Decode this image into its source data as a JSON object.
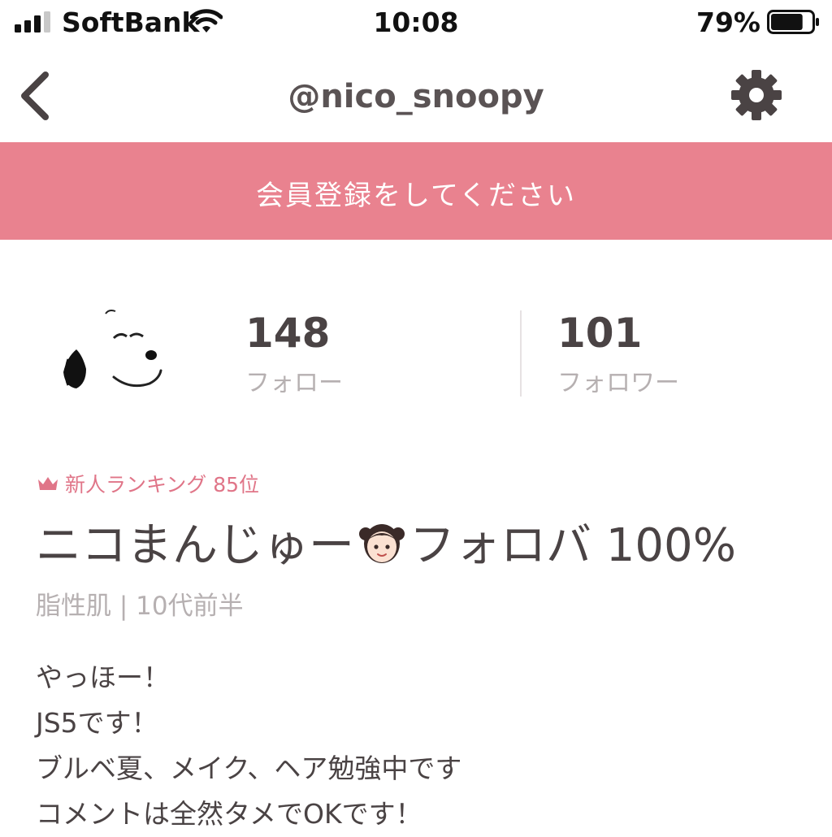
{
  "status_bar": {
    "carrier": "SoftBank",
    "time": "10:08",
    "battery_percent": "79%",
    "battery_level": 0.79
  },
  "nav": {
    "title": "@nico_snoopy",
    "back_icon": "chevron-left-icon",
    "settings_icon": "gear-icon"
  },
  "banner": {
    "text": "会員登録をしてください",
    "color": "#e9828f"
  },
  "profile": {
    "follow_count": "148",
    "follow_label": "フォロー",
    "follower_count": "101",
    "follower_label": "フォロワー",
    "rank_text": "新人ランキング 85位",
    "name_before": "ニコまんじゅー",
    "name_after": "フォロバ 100%",
    "meta": "脂性肌 | 10代前半",
    "bio": [
      "やっほー！",
      "JS5です！",
      "ブルベ夏、メイク、ヘア勉強中です",
      "コメントは全然タメでOKです！"
    ],
    "accent_color": "#e07588"
  }
}
